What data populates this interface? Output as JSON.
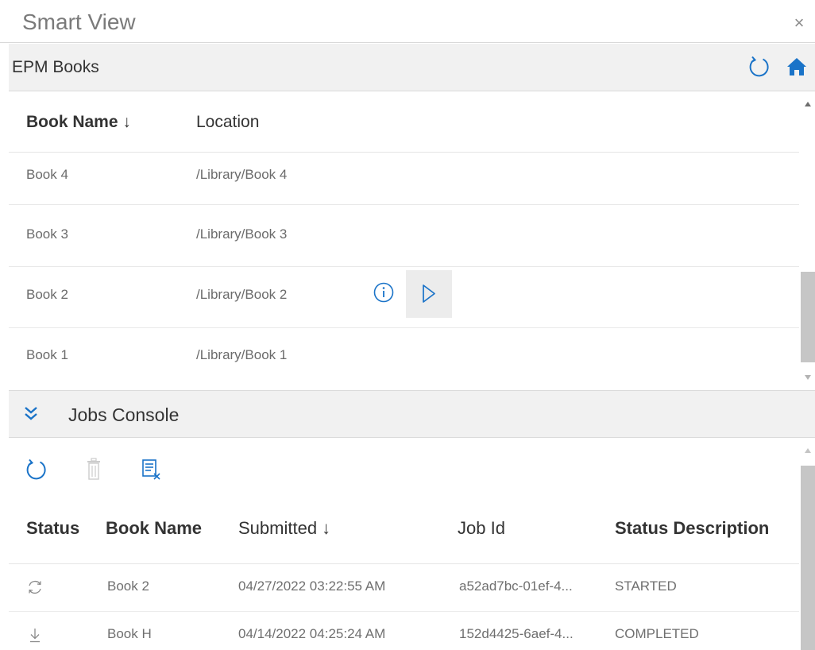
{
  "window": {
    "title": "Smart View",
    "close_label": "×"
  },
  "books_panel": {
    "title": "EPM Books",
    "columns": {
      "name": "Book Name ↓",
      "location": "Location"
    },
    "rows": [
      {
        "name": "Book 4",
        "location": "/Library/Book 4"
      },
      {
        "name": "Book 3",
        "location": "/Library/Book 3"
      },
      {
        "name": "Book 2",
        "location": "/Library/Book 2"
      },
      {
        "name": "Book 1",
        "location": "/Library/Book 1"
      }
    ],
    "hovered_row_actions": [
      "info-icon",
      "run-icon"
    ]
  },
  "jobs_panel": {
    "title": "Jobs Console",
    "toolbar": [
      "refresh-icon",
      "delete-icon",
      "clear-list-icon"
    ],
    "columns": {
      "status": "Status",
      "book_name": "Book Name",
      "submitted": "Submitted ↓",
      "job_id": "Job Id",
      "description": "Status Description"
    },
    "rows": [
      {
        "status_icon": "sync-icon",
        "book_name": "Book 2",
        "submitted": "04/27/2022 03:22:55 AM",
        "job_id": "a52ad7bc-01ef-4...",
        "description": "STARTED"
      },
      {
        "status_icon": "download-icon",
        "book_name": "Book H",
        "submitted": "04/14/2022 04:25:24 AM",
        "job_id": "152d4425-6aef-4...",
        "description": "COMPLETED"
      }
    ]
  },
  "colors": {
    "accent": "#1a73c8",
    "header_bg": "#f1f1f1",
    "scrollbar_thumb": "#c6c6c6"
  }
}
